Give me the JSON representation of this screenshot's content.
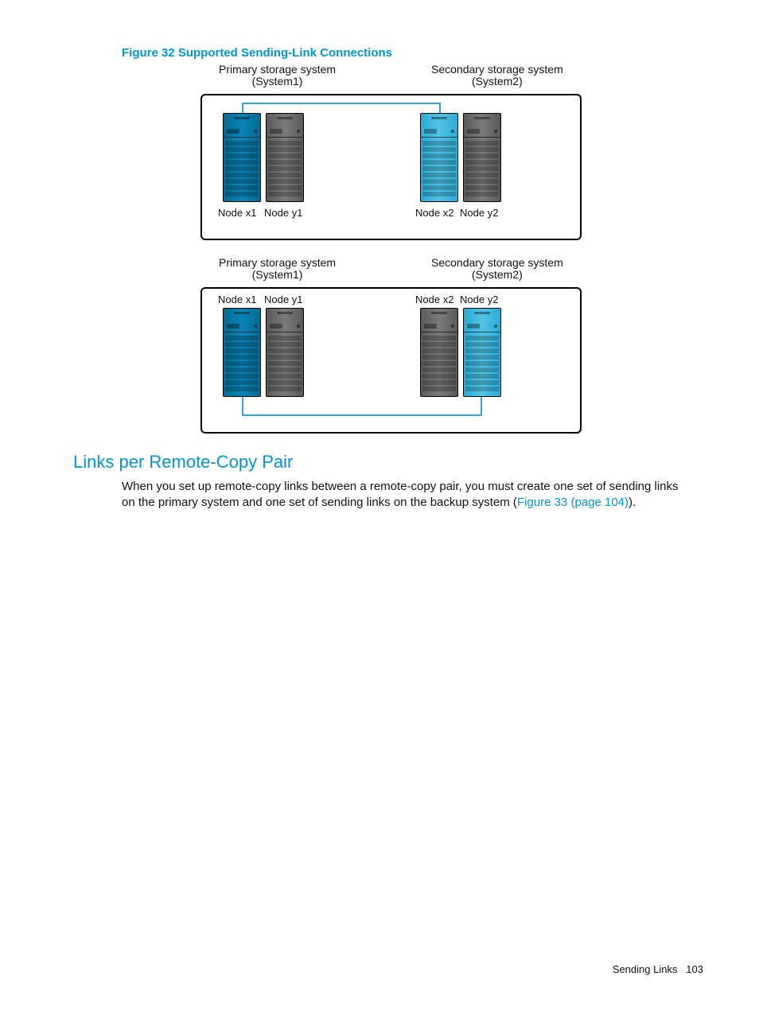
{
  "figure": {
    "caption": "Figure 32 Supported Sending-Link Connections",
    "diagram1": {
      "primary": {
        "title1": "Primary storage system",
        "title2": "(System1)",
        "nodeA": "Node x1",
        "nodeB": "Node y1"
      },
      "secondary": {
        "title1": "Secondary storage system",
        "title2": "(System2)",
        "nodeA": "Node x2",
        "nodeB": "Node y2"
      }
    },
    "diagram2": {
      "primary": {
        "title1": "Primary storage system",
        "title2": "(System1)",
        "nodeA": "Node x1",
        "nodeB": "Node y1"
      },
      "secondary": {
        "title1": "Secondary storage system",
        "title2": "(System2)",
        "nodeA": "Node x2",
        "nodeB": "Node y2"
      }
    }
  },
  "section": {
    "heading": "Links per Remote-Copy Pair",
    "body_pre": "When you set up remote-copy links between a remote-copy pair, you must create one set of sending links on the primary system and one set of sending links on the backup system (",
    "xref": "Figure 33 (page 104)",
    "body_post": ")."
  },
  "footer": {
    "section": "Sending Links",
    "page": "103"
  }
}
